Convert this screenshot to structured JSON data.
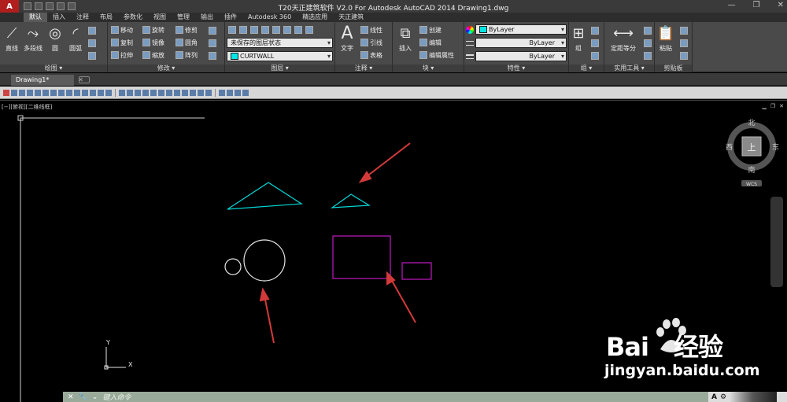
{
  "title": "T20天正建筑软件 V2.0 For Autodesk AutoCAD 2014    Drawing1.dwg",
  "window_controls": [
    "—",
    "❐",
    "✕"
  ],
  "ribbon_tabs": [
    "默认",
    "插入",
    "注释",
    "布局",
    "参数化",
    "视图",
    "管理",
    "输出",
    "插件",
    "Autodesk 360",
    "精选应用",
    "天正建筑"
  ],
  "panels": {
    "draw": {
      "title": "绘图 ▾",
      "line": "直线",
      "polyline": "多段线",
      "circle": "圆",
      "arc": "圆弧"
    },
    "modify": {
      "title": "修改 ▾",
      "move": "移动",
      "rotate": "旋转",
      "trim": "修剪",
      "copy": "复制",
      "mirror": "镜像",
      "fillet": "圆角",
      "stretch": "拉伸",
      "scale": "缩放",
      "array": "阵列"
    },
    "layers": {
      "title": "图层 ▾",
      "state": "未保存的图层状态",
      "current": "CURTWALL"
    },
    "annotation": {
      "title": "注释 ▾",
      "text": "文字",
      "linear": "线性",
      "leader": "引线",
      "table": "表格"
    },
    "block": {
      "title": "块 ▾",
      "insert": "插入",
      "create": "创建",
      "edit": "编辑",
      "attr": "编辑属性"
    },
    "properties": {
      "title": "特性 ▾",
      "color": "ByLayer",
      "linetype": "ByLayer",
      "lineweight": "ByLayer"
    },
    "groups": {
      "title": "组 ▾",
      "group": "组"
    },
    "utilities": {
      "title": "实用工具 ▾",
      "measure": "定距等分"
    },
    "clipboard": {
      "title": "剪贴板",
      "paste": "粘贴"
    }
  },
  "file_tab": "Drawing1*",
  "viewport_label": "[−][俯视][二维线框]",
  "viewcube": {
    "north": "北",
    "south": "南",
    "west": "西",
    "east": "东",
    "top": "上",
    "wcs": "WCS"
  },
  "ucs": {
    "x": "X",
    "y": "Y"
  },
  "command": {
    "placeholder": "键入命令"
  },
  "status": {
    "a": "A"
  },
  "watermark": {
    "brand": "Bai",
    "suffix": "经验",
    "url": "jingyan.baidu.com"
  },
  "colors": {
    "cyan": "#00d8d8",
    "magenta": "#c21bc2",
    "white": "#e6e6e6",
    "arrow": "#d23a3a"
  }
}
